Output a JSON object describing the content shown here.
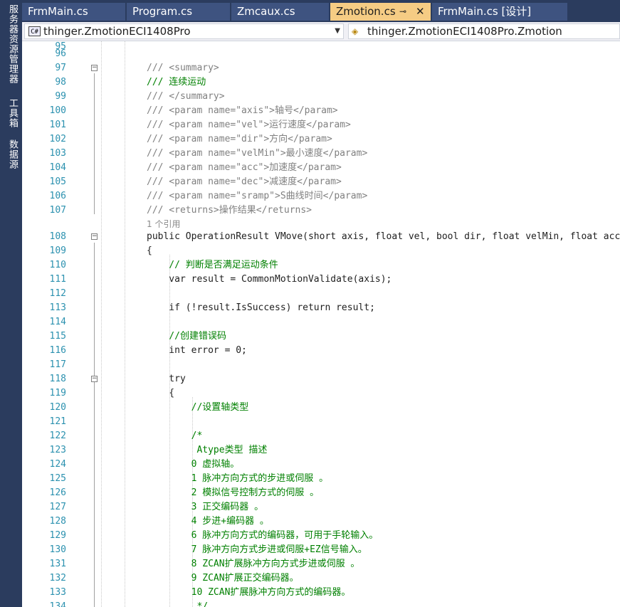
{
  "sidebar": {
    "tabs": [
      "服务器资源管理器",
      "工具箱",
      "数据源"
    ]
  },
  "tabs": [
    {
      "label": "FrmMain.cs"
    },
    {
      "label": "Program.cs"
    },
    {
      "label": "Zmcaux.cs"
    },
    {
      "label": "Zmotion.cs",
      "pin": "⊸",
      "close": "✕"
    },
    {
      "label": "FrmMain.cs [设计]"
    }
  ],
  "navbar": {
    "project": "thinger.ZmotionECI1408Pro",
    "project_icon": "C#",
    "class_path": "thinger.ZmotionECI1408Pro.Zmotion"
  },
  "editor": {
    "codelens": "1 个引用",
    "lines": [
      {
        "n": "95",
        "text": ""
      },
      {
        "n": "96",
        "text": ""
      },
      {
        "n": "97",
        "text": "/// <summary>"
      },
      {
        "n": "98",
        "text": "/// 连续运动"
      },
      {
        "n": "99",
        "text": "/// </summary>"
      },
      {
        "n": "100",
        "text": "/// <param name=\"axis\">轴号</param>"
      },
      {
        "n": "101",
        "text": "/// <param name=\"vel\">运行速度</param>"
      },
      {
        "n": "102",
        "text": "/// <param name=\"dir\">方向</param>"
      },
      {
        "n": "103",
        "text": "/// <param name=\"velMin\">最小速度</param>"
      },
      {
        "n": "104",
        "text": "/// <param name=\"acc\">加速度</param>"
      },
      {
        "n": "105",
        "text": "/// <param name=\"dec\">减速度</param>"
      },
      {
        "n": "106",
        "text": "/// <param name=\"sramp\">S曲线时间</param>"
      },
      {
        "n": "107",
        "text": "/// <returns>操作结果</returns>"
      },
      {
        "n": "108",
        "text": "public OperationResult VMove(short axis, float vel, bool dir, float velMin, float acc"
      },
      {
        "n": "109",
        "text": "{"
      },
      {
        "n": "110",
        "text": "    // 判断是否满足运动条件"
      },
      {
        "n": "111",
        "text": "    var result = CommonMotionValidate(axis);"
      },
      {
        "n": "112",
        "text": ""
      },
      {
        "n": "113",
        "text": "    if (!result.IsSuccess) return result;"
      },
      {
        "n": "114",
        "text": ""
      },
      {
        "n": "115",
        "text": "    //创建错误码"
      },
      {
        "n": "116",
        "text": "    int error = 0;"
      },
      {
        "n": "117",
        "text": ""
      },
      {
        "n": "118",
        "text": "    try"
      },
      {
        "n": "119",
        "text": "    {"
      },
      {
        "n": "120",
        "text": "        //设置轴类型"
      },
      {
        "n": "121",
        "text": ""
      },
      {
        "n": "122",
        "text": "        /*"
      },
      {
        "n": "123",
        "text": "         Atype类型 描述"
      },
      {
        "n": "124",
        "text": "        0 虚拟轴。"
      },
      {
        "n": "125",
        "text": "        1 脉冲方向方式的步进或伺服 。"
      },
      {
        "n": "126",
        "text": "        2 模拟信号控制方式的伺服 。"
      },
      {
        "n": "127",
        "text": "        3 正交编码器 。"
      },
      {
        "n": "128",
        "text": "        4 步进+编码器 。"
      },
      {
        "n": "129",
        "text": "        6 脉冲方向方式的编码器，可用于手轮输入。"
      },
      {
        "n": "130",
        "text": "        7 脉冲方向方式步进或伺服+EZ信号输入。"
      },
      {
        "n": "131",
        "text": "        8 ZCAN扩展脉冲方向方式步进或伺服 。"
      },
      {
        "n": "132",
        "text": "        9 ZCAN扩展正交编码器。"
      },
      {
        "n": "133",
        "text": "        10 ZCAN扩展脉冲方向方式的编码器。"
      },
      {
        "n": "134",
        "text": "         */"
      }
    ]
  }
}
